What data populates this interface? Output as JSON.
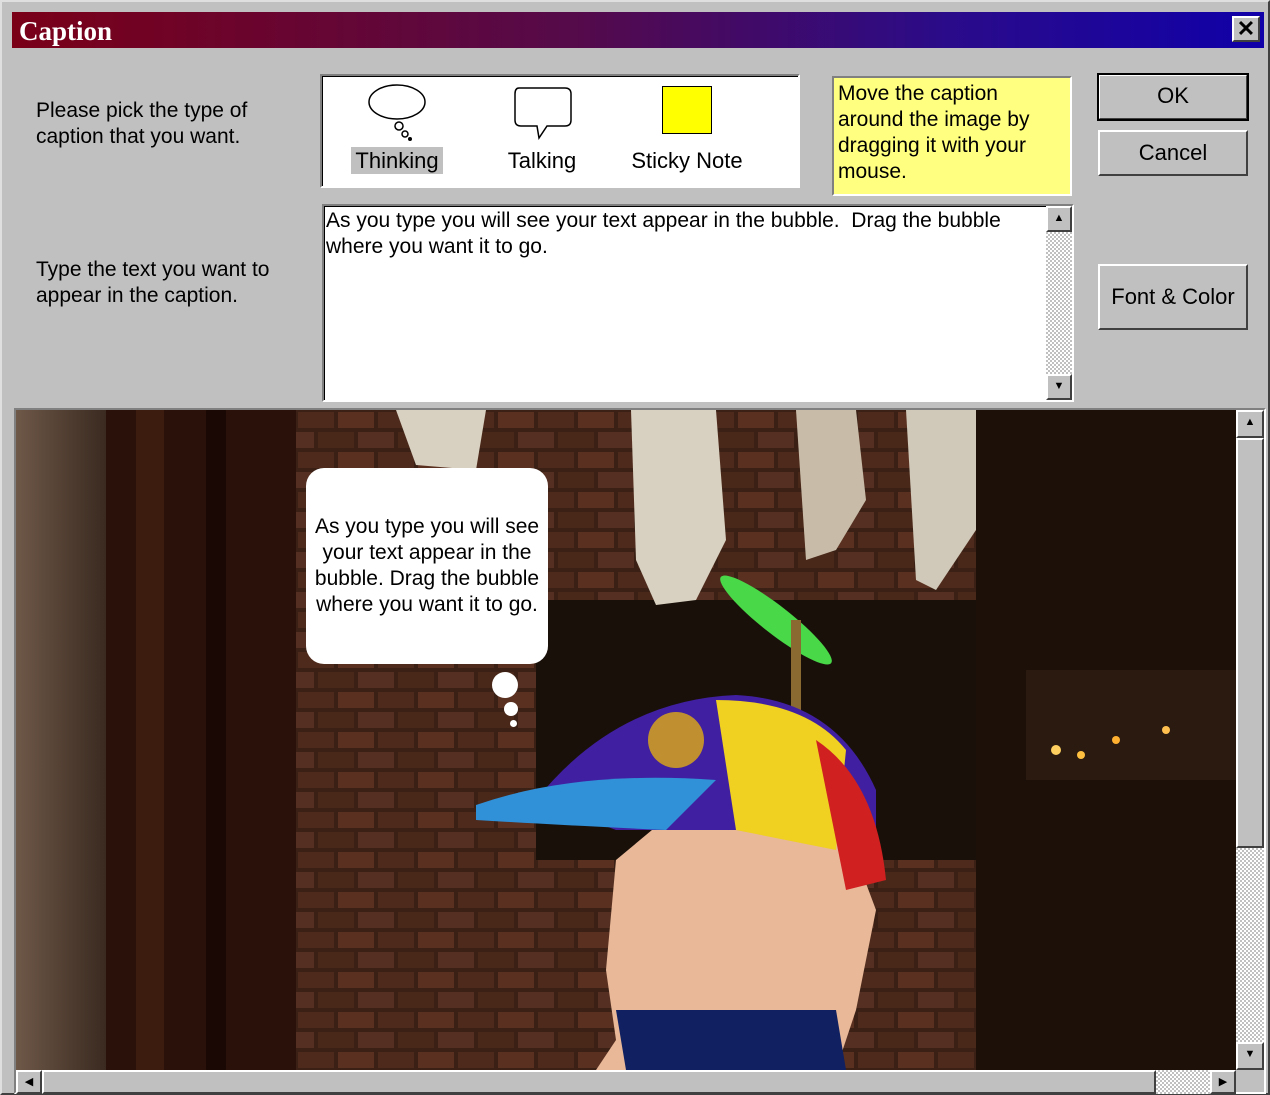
{
  "window": {
    "title": "Caption",
    "close_label": "✕"
  },
  "instructions": {
    "pick_type": "Please pick the type of caption that you want.",
    "type_text": "Type the text you want to appear in the caption."
  },
  "caption_types": [
    {
      "label": "Thinking",
      "icon": "thought-bubble-icon",
      "selected": true
    },
    {
      "label": "Talking",
      "icon": "speech-bubble-icon",
      "selected": false
    },
    {
      "label": "Sticky Note",
      "icon": "sticky-note-icon",
      "selected": false
    }
  ],
  "hint_text": "Move the caption around the image by dragging it with your mouse.",
  "buttons": {
    "ok": "OK",
    "cancel": "Cancel",
    "font_color": "Font & Color"
  },
  "caption_text": "As you type you will see your text appear in the bubble.  Drag the bubble where you want it to go.",
  "bubble_text": "As you type you will see your text appear in the bubble.  Drag the bubble where you want it to go.",
  "colors": {
    "hint_background": "#ffff80",
    "sticky_note": "#ffff00"
  },
  "scroll_arrows": {
    "up": "▲",
    "down": "▼",
    "left": "◀",
    "right": "▶"
  }
}
